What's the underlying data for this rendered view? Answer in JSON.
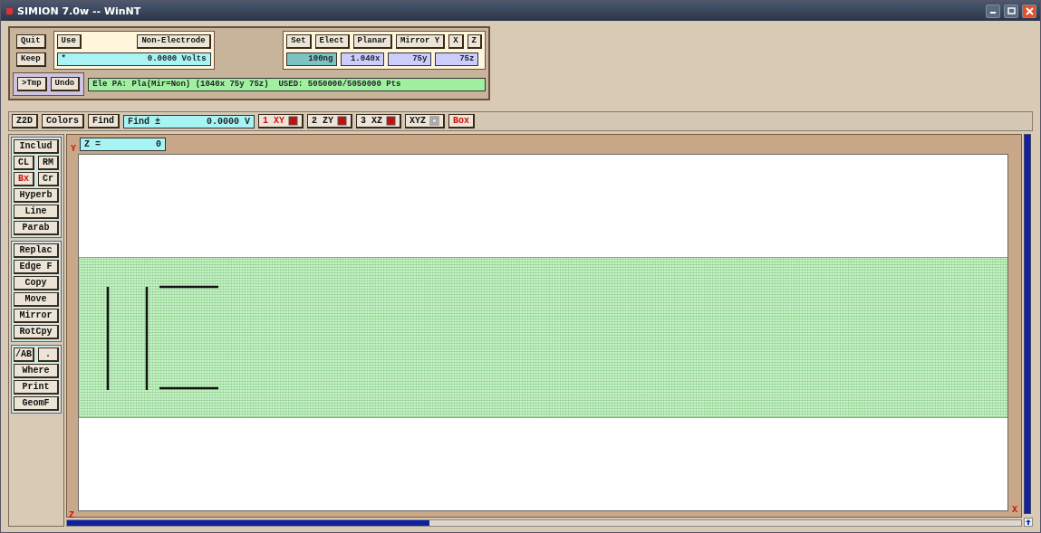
{
  "window": {
    "title": "SIMION 7.0w -- WinNT"
  },
  "top_panel": {
    "quit": "Quit",
    "keep": "Keep",
    "tmp": ">Tmp",
    "undo": "Undo",
    "use": "Use",
    "electrode_type": "Non-Electrode",
    "potential_field": {
      "marker": "*",
      "value": "0.0000 Volts"
    },
    "set_buttons": [
      "Set",
      "Elect",
      "Planar",
      "Mirror Y",
      "X",
      "Z"
    ],
    "size_fields": [
      {
        "value": "100ng",
        "selected": true
      },
      {
        "value": "1.040x",
        "selected": false
      },
      {
        "value": "75y",
        "selected": false
      },
      {
        "value": "75z",
        "selected": false
      }
    ],
    "status": "Ele PA: Pla(Mir=Non) (1040x 75y 75z)  USED: 5050000/5050000 Pts"
  },
  "view_toolbar": [
    {
      "kind": "button",
      "label": "Z2D"
    },
    {
      "kind": "button",
      "label": "Colors"
    },
    {
      "kind": "button",
      "label": "Find"
    },
    {
      "kind": "field",
      "label": "Find ±",
      "value": "0.0000 V"
    },
    {
      "kind": "view",
      "label": "1 XY",
      "selected": true
    },
    {
      "kind": "view",
      "label": "2 ZY",
      "selected": false
    },
    {
      "kind": "view",
      "label": "3 XZ",
      "selected": false
    },
    {
      "kind": "view3d",
      "label": "XYZ",
      "selected": false
    },
    {
      "kind": "toggle",
      "label": "Box",
      "on": true
    }
  ],
  "tools": [
    {
      "rows": [
        [
          {
            "label": "Includ",
            "selected": false
          }
        ],
        [
          {
            "label": "CL",
            "selected": false
          },
          {
            "label": "RM",
            "selected": false
          }
        ],
        [
          {
            "label": "Bx",
            "selected": true
          },
          {
            "label": "Cr",
            "selected": false
          }
        ],
        [
          {
            "label": "Hyperb",
            "selected": false
          }
        ],
        [
          {
            "label": "Line",
            "selected": false
          }
        ],
        [
          {
            "label": "Parab",
            "selected": false
          }
        ]
      ]
    },
    {
      "rows": [
        [
          {
            "label": "Replac",
            "selected": false
          }
        ],
        [
          {
            "label": "Edge F",
            "selected": false
          }
        ],
        [
          {
            "label": "Copy",
            "selected": false
          }
        ],
        [
          {
            "label": "Move",
            "selected": false
          }
        ],
        [
          {
            "label": "Mirror",
            "selected": false
          }
        ],
        [
          {
            "label": "RotCpy",
            "selected": false
          }
        ]
      ]
    },
    {
      "rows": [
        [
          {
            "label": "/AB",
            "selected": false
          },
          {
            "label": ".",
            "selected": false
          }
        ],
        [
          {
            "label": "Where",
            "selected": false
          }
        ],
        [
          {
            "label": "Print",
            "selected": false
          }
        ],
        [
          {
            "label": "GeomF",
            "selected": false
          }
        ]
      ]
    }
  ],
  "slice_field": {
    "label": "Z =",
    "value": "0"
  },
  "axis_labels": {
    "y": "Y",
    "x": "X",
    "z": "Z"
  }
}
